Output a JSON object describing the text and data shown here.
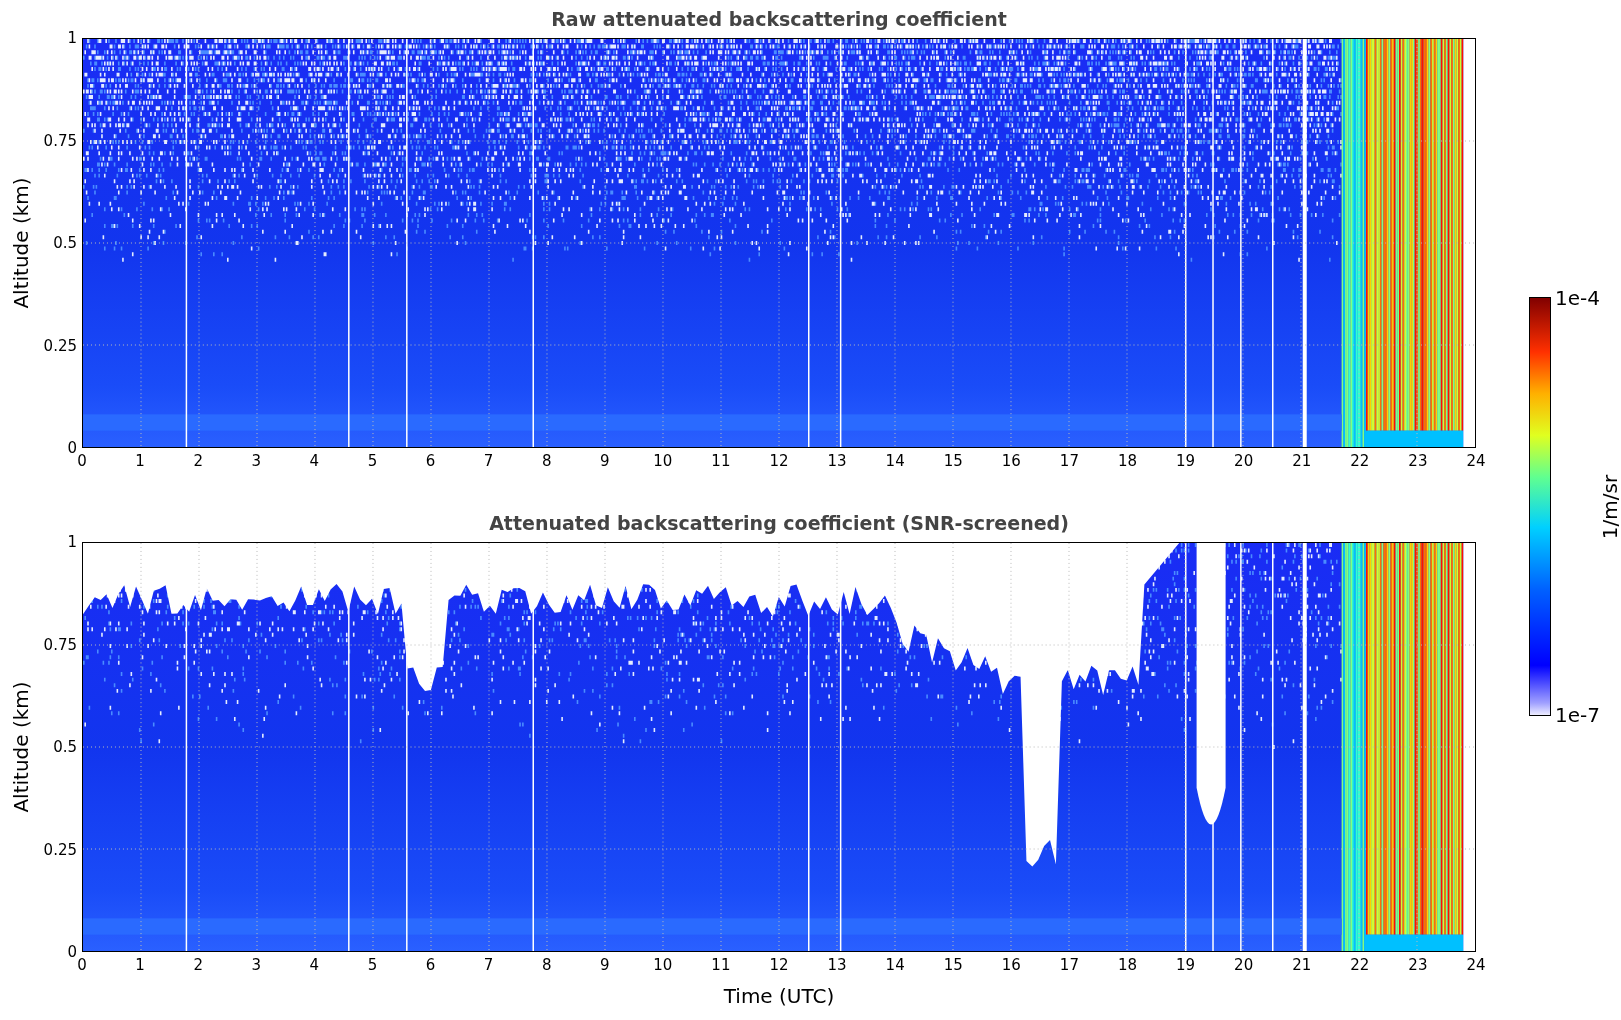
{
  "panels": [
    {
      "kind": "raw",
      "title": "Raw attenuated backscattering coefficient",
      "ylabel": "Altitude (km)",
      "yticks": [
        "1",
        "0.75",
        "0.5",
        "0.25",
        "0"
      ],
      "xticks": [
        "0",
        "1",
        "2",
        "3",
        "4",
        "5",
        "6",
        "7",
        "8",
        "9",
        "10",
        "11",
        "12",
        "13",
        "14",
        "15",
        "16",
        "17",
        "18",
        "19",
        "20",
        "21",
        "22",
        "23",
        "24"
      ]
    },
    {
      "kind": "screened",
      "title": "Attenuated backscattering coefficient (SNR-screened)",
      "ylabel": "Altitude (km)",
      "yticks": [
        "1",
        "0.75",
        "0.5",
        "0.25",
        "0"
      ],
      "xticks": [
        "0",
        "1",
        "2",
        "3",
        "4",
        "5",
        "6",
        "7",
        "8",
        "9",
        "10",
        "11",
        "12",
        "13",
        "14",
        "15",
        "16",
        "17",
        "18",
        "19",
        "20",
        "21",
        "22",
        "23",
        "24"
      ]
    }
  ],
  "xlabel": "Time (UTC)",
  "colorbar": {
    "max_label": "1e-4",
    "min_label": "1e-7",
    "label": "1/m/sr"
  }
}
